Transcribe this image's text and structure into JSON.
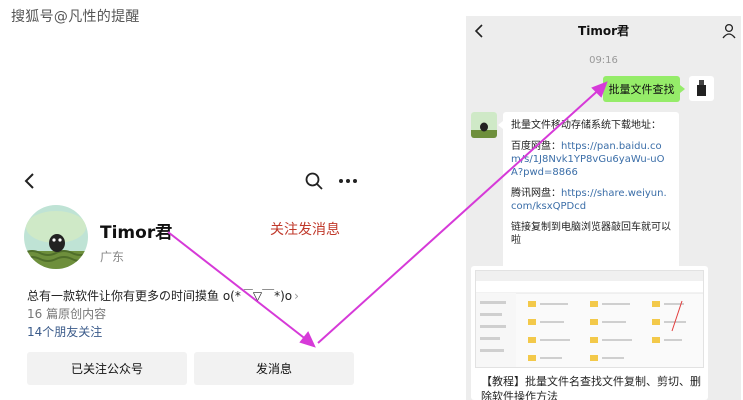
{
  "watermark": "搜狐号@凡性的提醒",
  "profile": {
    "name": "Timor君",
    "region": "广东",
    "follow_message_link": "关注发消息",
    "bio": "总有一款软件让你有更多の时间摸鱼 o(*￣▽￣*)o",
    "articles": "16 篇原创内容",
    "friends": "14个朋友关注",
    "followed_button": "已关注公众号",
    "message_button": "发消息",
    "accent_color": "#c0392b"
  },
  "chat": {
    "title": "Timor君",
    "time": "09:16",
    "sent_message": "批量文件查找",
    "reply": {
      "intro": "批量文件移动存储系统下载地址：",
      "baidu_label": "百度网盘：",
      "baidu_link": "https://pan.baidu.com/s/1J8Nvk1YP8vGu6yaWu-uOA?pwd=8866",
      "weiyun_label": "腾讯网盘：",
      "weiyun_link": "https://share.weiyun.com/ksxQPDcd",
      "note": "链接复制到电脑浏览器敲回车就可以啦"
    },
    "article_card_title": "【教程】批量文件名查找文件复制、剪切、删除软件操作方法",
    "bubble_color": "#95ec69"
  },
  "annotation_color": "#d63ad8"
}
